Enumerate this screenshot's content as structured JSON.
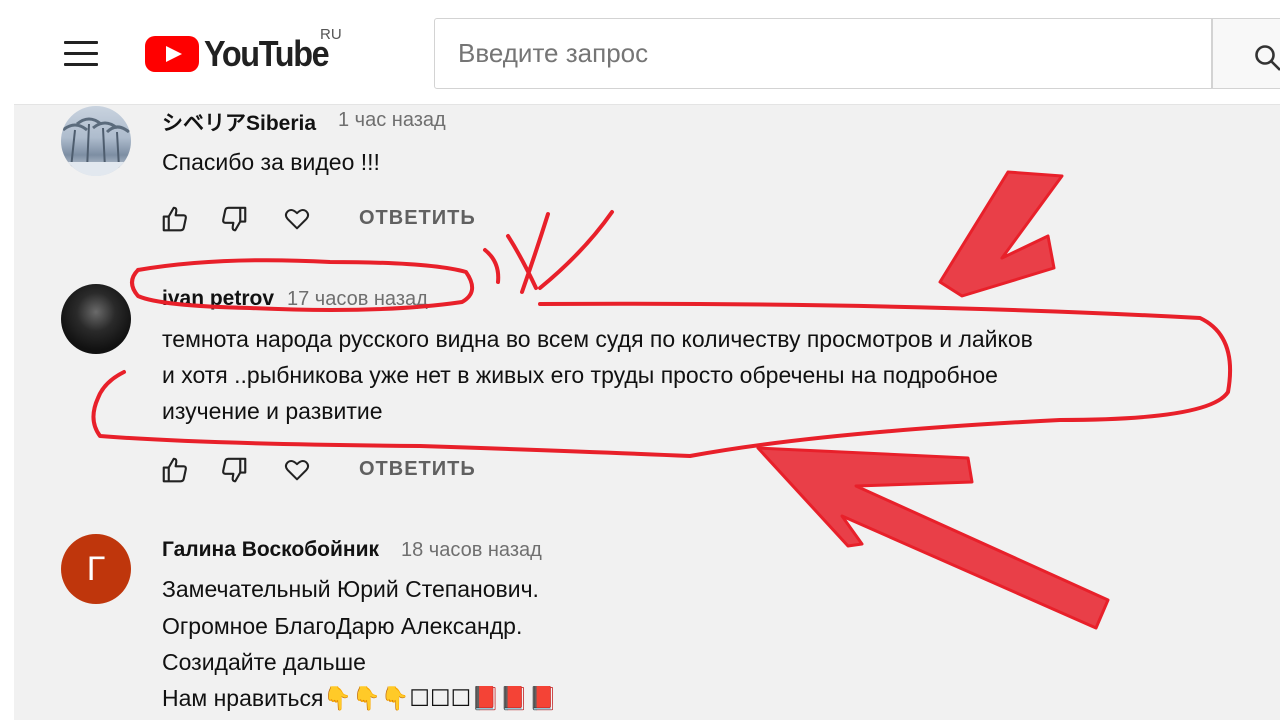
{
  "header": {
    "logo_text": "YouTube",
    "region": "RU",
    "search_placeholder": "Введите запрос"
  },
  "comments": [
    {
      "author": "シベリアSiberia",
      "time": "1 час назад",
      "lines": [
        "Спасибо за видео !!!"
      ],
      "reply_label": "ОТВЕТИТЬ"
    },
    {
      "author": "ivan petrov",
      "time": "17 часов назад",
      "lines": [
        "темнота народа русского видна во всем судя по количеству просмотров и лайков",
        "и хотя ..рыбникова уже нет в живых его труды просто обречены на подробное",
        "изучение и развитие"
      ],
      "reply_label": "ОТВЕТИТЬ"
    },
    {
      "author": "Галина Воскобойник",
      "avatar_letter": "Г",
      "time": "18 часов назад",
      "lines": [
        "Замечательный Юрий Степанович.",
        "Огромное БлагоДарю Александр.",
        "Созидайте дальше",
        "Нам нравиться👇👇👇☐☐☐📕📕📕"
      ]
    }
  ],
  "colors": {
    "brand_red": "#ff0000",
    "annotation_red": "#e8202a",
    "avatar_galina": "#bf360c",
    "secondary_text": "#606060"
  },
  "icons": [
    "menu-icon",
    "youtube-play-icon",
    "search-icon",
    "thumb-up-icon",
    "thumb-down-icon",
    "heart-icon"
  ]
}
